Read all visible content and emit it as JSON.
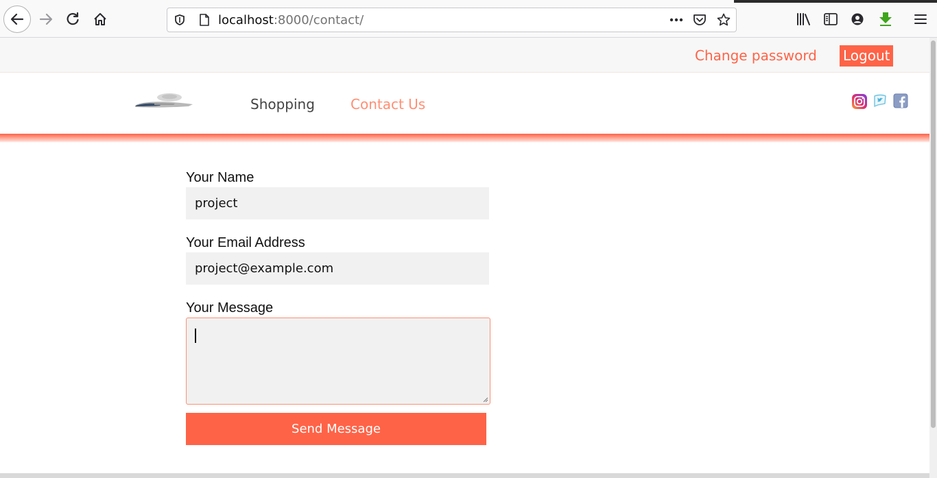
{
  "browser": {
    "url_host": "localhost",
    "url_path": ":8000/contact/",
    "icons": {
      "back": "back-arrow-icon",
      "forward": "forward-arrow-icon",
      "reload": "reload-icon",
      "home": "home-icon",
      "shield": "shield-icon",
      "page": "page-icon",
      "more": "more-dots-icon",
      "pocket": "pocket-icon",
      "bookmark": "star-icon",
      "library": "library-icon",
      "sidebar": "sidebar-icon",
      "account": "account-icon",
      "download": "download-icon",
      "menu": "hamburger-menu-icon"
    }
  },
  "topbar": {
    "change_password": "Change password",
    "logout": "Logout"
  },
  "header": {
    "nav": {
      "shopping": "Shopping",
      "contact": "Contact Us"
    },
    "social": [
      "instagram-icon",
      "twitter-icon",
      "facebook-icon"
    ]
  },
  "form": {
    "name_label": "Your Name",
    "name_value": "project",
    "email_label": "Your Email Address",
    "email_value": "project@example.com",
    "message_label": "Your Message",
    "message_value": "",
    "submit_label": "Send Message"
  },
  "colors": {
    "accent": "#ff6347",
    "accent_light": "#ff8f73",
    "field_bg": "#f1f1f1"
  }
}
